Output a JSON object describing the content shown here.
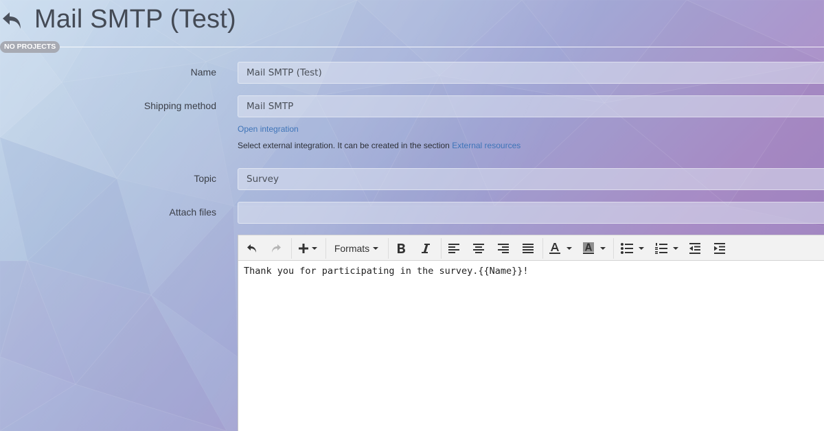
{
  "header": {
    "title": "Mail SMTP (Test)",
    "project_badge": "NO PROJECTS"
  },
  "form": {
    "name": {
      "label": "Name",
      "value": "Mail SMTP (Test)"
    },
    "shipping_method": {
      "label": "Shipping method",
      "value": "Mail SMTP",
      "open_integration_link": "Open integration",
      "help_text": "Select external integration. It can be created in the section",
      "help_link": "External resources"
    },
    "topic": {
      "label": "Topic",
      "value": "Survey"
    },
    "attach_files": {
      "label": "Attach files",
      "value": ""
    }
  },
  "editor": {
    "toolbar": {
      "formats_label": "Formats",
      "icons": [
        "undo-icon",
        "redo-icon",
        "insert-icon",
        "bold-icon",
        "italic-icon",
        "align-left-icon",
        "align-center-icon",
        "align-right-icon",
        "align-justify-icon",
        "text-color-icon",
        "background-color-icon",
        "bullet-list-icon",
        "numbered-list-icon",
        "outdent-icon",
        "indent-icon"
      ]
    },
    "body": "Thank you for participating in the survey.{{Name}}!"
  },
  "colors": {
    "link": "#3e74b8",
    "badge_bg": "#a7aab3",
    "title": "#444a55"
  }
}
